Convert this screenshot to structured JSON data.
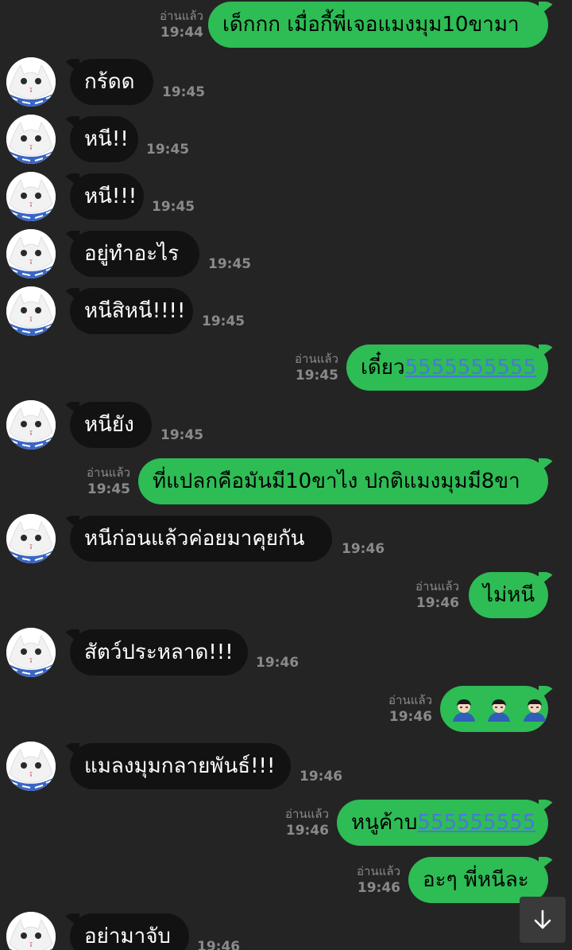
{
  "chat": {
    "read_label": "อ่านแล้ว",
    "messages": [
      {
        "dir": "out",
        "text": "เด็กกก เมื่อกี้พี่เจอแมงมุม10ขามา",
        "time": "19:44"
      },
      {
        "dir": "in",
        "text": "กร้ดด",
        "time": "19:45"
      },
      {
        "dir": "in",
        "text": "หนี!!",
        "time": "19:45"
      },
      {
        "dir": "in",
        "text": "หนี!!!",
        "time": "19:45"
      },
      {
        "dir": "in",
        "text": "อยู่ทำอะไร",
        "time": "19:45"
      },
      {
        "dir": "in",
        "text": "หนีสิหนี!!!!",
        "time": "19:45"
      },
      {
        "dir": "out",
        "text": "เดี๋ยว",
        "link": "5555555555",
        "time": "19:45"
      },
      {
        "dir": "in",
        "text": "หนียัง",
        "time": "19:45"
      },
      {
        "dir": "out",
        "text": "ที่แปลกคือมันมี10ขาไง ปกติแมงมุมมี8ขา",
        "time": "19:45"
      },
      {
        "dir": "in",
        "text": "หนีก่อนแล้วค่อยมาคุยกัน",
        "time": "19:46"
      },
      {
        "dir": "out",
        "text": "ไม่หนี",
        "time": "19:46"
      },
      {
        "dir": "in",
        "text": "สัตว์ประหลาด!!!",
        "time": "19:46"
      },
      {
        "dir": "out",
        "emoji": "person-bowing-emoji",
        "emoji_count": 3,
        "time": "19:46"
      },
      {
        "dir": "in",
        "text": "แมลงมุมกลายพันธ์!!!",
        "time": "19:46"
      },
      {
        "dir": "out",
        "text": "หนูค้าบ",
        "link": "555555555",
        "time": "19:46"
      },
      {
        "dir": "out",
        "text": "อะๆ พี่หนีละ",
        "time": "19:46"
      },
      {
        "dir": "in",
        "text": "อย่ามาจับ",
        "time": "19:46"
      }
    ]
  },
  "icons": {
    "avatar": "white-cat-avatar-icon",
    "scroll_down": "arrow-down-icon"
  },
  "colors": {
    "background": "#242424",
    "outgoing_bubble": "#2ebc55",
    "incoming_bubble": "#121212",
    "link": "#4a78d8",
    "meta_text": "#8a8a8a"
  }
}
